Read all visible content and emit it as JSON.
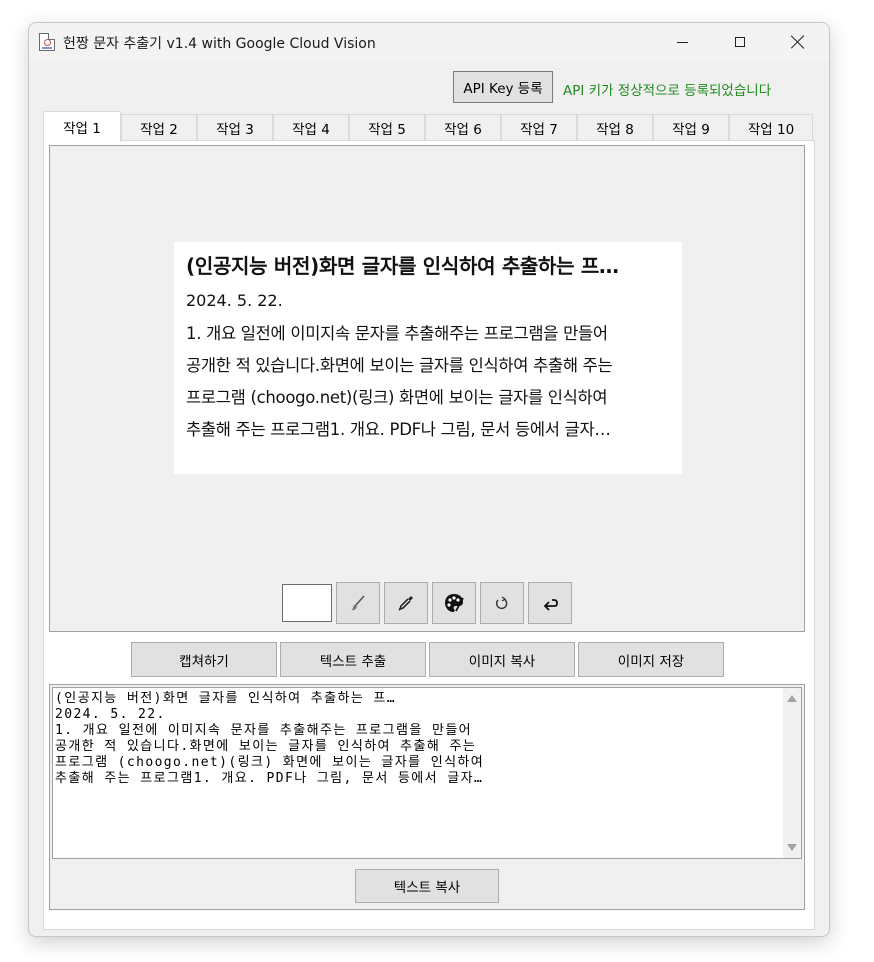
{
  "window": {
    "title": "헌짱 문자 추출기 v1.4 with Google Cloud Vision",
    "minimize_icon": "minimize-icon",
    "maximize_icon": "maximize-icon",
    "close_icon": "close-icon"
  },
  "api": {
    "button_label": "API Key 등록",
    "status_text": "API 키가 정상적으로 등록되었습니다",
    "status_color": "#1f8a1f"
  },
  "tabs": [
    {
      "label": "작업 1",
      "active": true
    },
    {
      "label": "작업 2"
    },
    {
      "label": "작업 3"
    },
    {
      "label": "작업 4"
    },
    {
      "label": "작업 5"
    },
    {
      "label": "작업 6"
    },
    {
      "label": "작업 7"
    },
    {
      "label": "작업 8"
    },
    {
      "label": "작업 9"
    },
    {
      "label": "작업 10"
    }
  ],
  "captured_image": {
    "title": "(인공지능 버전)화면 글자를 인식하여 추출하는 프…",
    "date": "2024. 5. 22.",
    "lines": [
      "1. 개요 일전에  이미지속 문자를 추출해주는 프로그램을 만들어",
      "공개한 적 있습니다.화면에 보이는 글자를 인식하여 추출해 주는",
      "프로그램 (choogo.net)(링크) 화면에 보이는 글자를 인식하여",
      "추출해 주는 프로그램1. 개요. PDF나 그림, 문서 등에서 글자…"
    ]
  },
  "tools": {
    "color_swatch": "#ffffff",
    "icons": [
      "brush-icon",
      "eyedropper-icon",
      "palette-icon",
      "rotate-icon",
      "undo-icon"
    ]
  },
  "actions": {
    "capture": "캡쳐하기",
    "extract_text": "텍스트 추출",
    "copy_image": "이미지 복사",
    "save_image": "이미지 저장"
  },
  "output": {
    "text": "(인공지능 버전)화면 글자를 인식하여 추출하는 프…\n2024. 5. 22.\n1. 개요 일전에 이미지속 문자를 추출해주는 프로그램을 만들어\n공개한 적 있습니다.화면에 보이는 글자를 인식하여 추출해 주는\n프로그램 (choogo.net)(링크) 화면에 보이는 글자를 인식하여\n추출해 주는 프로그램1. 개요. PDF나 그림, 문서 등에서 글자…",
    "copy_button": "텍스트 복사"
  }
}
